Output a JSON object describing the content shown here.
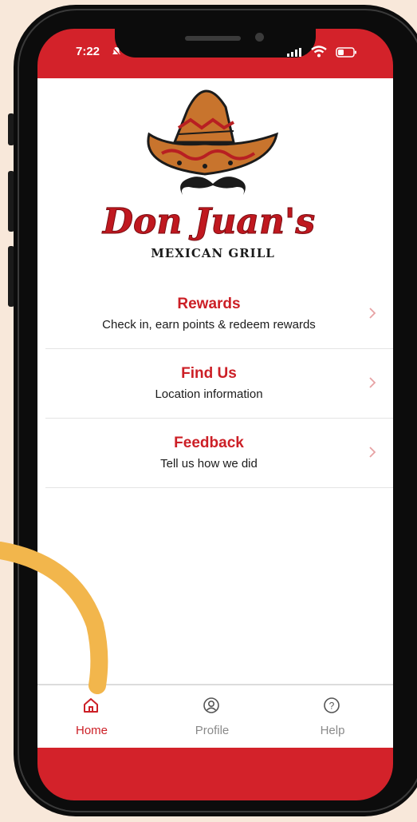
{
  "status_bar": {
    "time": "7:22"
  },
  "brand": {
    "name": "Don Juan's",
    "tagline": "MEXICAN GRILL"
  },
  "menu": [
    {
      "title": "Rewards",
      "subtitle": "Check in, earn points & redeem rewards"
    },
    {
      "title": "Find Us",
      "subtitle": "Location information"
    },
    {
      "title": "Feedback",
      "subtitle": "Tell us how we did"
    }
  ],
  "tabs": [
    {
      "label": "Home",
      "icon": "home-icon",
      "active": true
    },
    {
      "label": "Profile",
      "icon": "profile-icon",
      "active": false
    },
    {
      "label": "Help",
      "icon": "help-icon",
      "active": false
    }
  ],
  "colors": {
    "accent": "#cc1f26",
    "page_background": "#f8e8da",
    "arc": "#f2b64c"
  }
}
